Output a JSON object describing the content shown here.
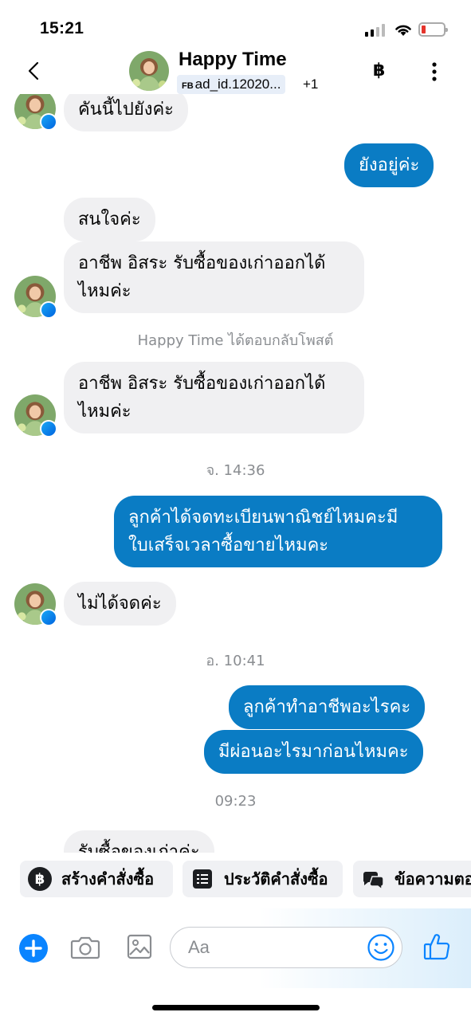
{
  "status_bar": {
    "time": "15:21"
  },
  "header": {
    "name": "Happy Time",
    "source_badge": "FB",
    "ad_id": "ad_id.12020...",
    "extra_count": "+1",
    "currency_icon": "฿"
  },
  "messages": [
    {
      "type": "incoming",
      "text": "คันนี้ไปยังค่ะ"
    },
    {
      "type": "outgoing",
      "text": "ยังอยู่ค่ะ"
    },
    {
      "type": "incoming",
      "text": "สนใจค่ะ"
    },
    {
      "type": "incoming",
      "lines": [
        "อาชีพ อิสระ รับซื้อของเก่าออกได้",
        "ไหมค่ะ"
      ]
    },
    {
      "type": "system",
      "text": "Happy Time ได้ตอบกลับโพสต์"
    },
    {
      "type": "incoming",
      "lines": [
        "อาชีพ อิสระ รับซื้อของเก่าออกได้",
        "ไหมค่ะ"
      ]
    },
    {
      "type": "timestamp",
      "text": "จ. 14:36"
    },
    {
      "type": "outgoing",
      "lines": [
        "ลูกค้าได้จดทะเบียนพาณิชย์ไหมคะมี",
        "ใบเสร็จเวลาซื้อขายไหมคะ"
      ]
    },
    {
      "type": "incoming",
      "text": "ไม่ได้จดค่ะ"
    },
    {
      "type": "timestamp",
      "text": "อ. 10:41"
    },
    {
      "type": "outgoing",
      "text": "ลูกค้าทำอาชีพอะไรคะ"
    },
    {
      "type": "outgoing",
      "text": "มีผ่อนอะไรมาก่อนไหมคะ"
    },
    {
      "type": "timestamp",
      "text": "09:23"
    },
    {
      "type": "incoming",
      "text": "รับซื้อของเก่าค่ะ"
    }
  ],
  "quick_replies": [
    {
      "label": "สร้างคำสั่งซื้อ",
      "icon": "baht-circle-icon"
    },
    {
      "label": "ประวัติคำสั่งซื้อ",
      "icon": "receipt-icon"
    },
    {
      "label": "ข้อความตอบกลับ",
      "icon": "chat-bubbles-icon"
    }
  ],
  "composer": {
    "placeholder": "Aa"
  },
  "colors": {
    "outgoing_bubble": "#0a7cc4",
    "incoming_bubble": "#f0f0f2",
    "accent": "#0a84ff"
  }
}
